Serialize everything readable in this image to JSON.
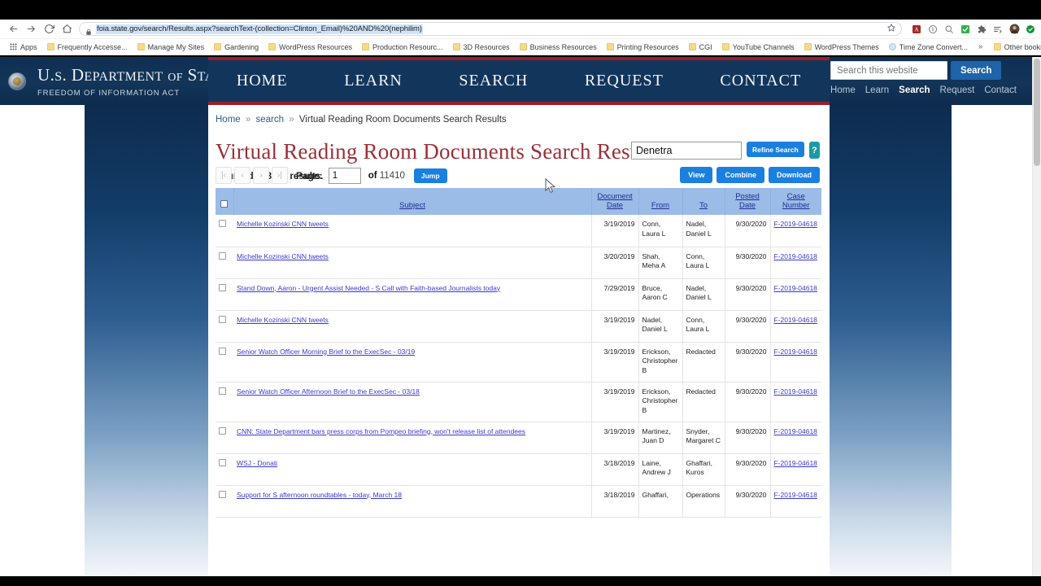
{
  "browser": {
    "url": "foia.state.gov/search/Results.aspx?searchText-(collection=Clinton_Email)%20AND%20(nephilim)",
    "back_icon": "back-arrow-icon",
    "forward_icon": "forward-arrow-icon",
    "reload_icon": "reload-icon",
    "home_icon": "home-icon",
    "lock_icon": "lock-icon",
    "star_icon": "bookmark-star-icon",
    "toolbar_icons": [
      "adobe-pdf-icon",
      "search-circle-icon",
      "magnifier-icon",
      "green-check-icon",
      "extensions-puzzle-icon",
      "reading-list-icon",
      "profile-avatar-icon",
      "update-circle-icon"
    ],
    "bookmarks": [
      {
        "label": "Apps",
        "icon": "apps-grid-icon"
      },
      {
        "label": "Frequently Accesse...",
        "icon": "folder-icon"
      },
      {
        "label": "Manage My Sites",
        "icon": "folder-icon"
      },
      {
        "label": "Gardening",
        "icon": "folder-icon"
      },
      {
        "label": "WordPress Resources",
        "icon": "folder-icon"
      },
      {
        "label": "Production Resourc...",
        "icon": "folder-icon"
      },
      {
        "label": "3D Resources",
        "icon": "folder-icon"
      },
      {
        "label": "Business Resources",
        "icon": "folder-icon"
      },
      {
        "label": "Printing Resources",
        "icon": "folder-icon"
      },
      {
        "label": "CGI",
        "icon": "folder-icon"
      },
      {
        "label": "YouTube Channels",
        "icon": "folder-icon"
      },
      {
        "label": "WordPress Themes",
        "icon": "folder-icon"
      },
      {
        "label": "Time Zone Convert...",
        "icon": "link-icon"
      }
    ],
    "overflow_label": "»",
    "other_bookmarks": {
      "label": "Other bookmarks",
      "icon": "folder-icon"
    }
  },
  "site_header": {
    "seal_icon": "department-of-state-seal-icon",
    "title_us": "U.S. D",
    "title_line": "U.S. DEPARTMENT OF STATE",
    "subtitle": "FREEDOM OF INFORMATION ACT",
    "search_placeholder": "Search this website",
    "search_value": "",
    "search_button": "Search",
    "mini_links": [
      {
        "label": "Home",
        "active": false
      },
      {
        "label": "Learn",
        "active": false
      },
      {
        "label": "Search",
        "active": true
      },
      {
        "label": "Request",
        "active": false
      },
      {
        "label": "Contact",
        "active": false
      }
    ]
  },
  "main_nav": [
    "HOME",
    "LEARN",
    "SEARCH",
    "REQUEST",
    "CONTACT"
  ],
  "breadcrumb": {
    "items": [
      "Home",
      "search"
    ],
    "current": "Virtual Reading Room Documents Search Results",
    "separator": "»"
  },
  "page": {
    "title": "Virtual Reading Room Documents Search Results",
    "returned": "returned 228195 results."
  },
  "refine": {
    "input_value": "Denetra",
    "input_placeholder": "",
    "refine_button": "Refine Search",
    "help_button": "?",
    "view_button": "View",
    "combine_button": "Combine",
    "download_button": "Download"
  },
  "pager": {
    "first_icon": "first-page-icon",
    "prev_icon": "previous-page-icon",
    "next_icon": "next-page-icon",
    "last_icon": "last-page-icon",
    "first_glyph": "|‹",
    "prev_glyph": "‹",
    "next_glyph": "›",
    "last_glyph": "›|",
    "page_label": "Page:",
    "page_value": "1",
    "of_label": "of",
    "total_pages": "11410",
    "jump_button": "Jump"
  },
  "table": {
    "select_all_name": "select-all-checkbox",
    "columns": [
      {
        "key": "check",
        "label": ""
      },
      {
        "key": "subject",
        "label": "Subject"
      },
      {
        "key": "docdate",
        "label": "Document Date"
      },
      {
        "key": "from",
        "label": "From"
      },
      {
        "key": "to",
        "label": "To"
      },
      {
        "key": "posted",
        "label": "Posted Date"
      },
      {
        "key": "case",
        "label": "Case Number"
      }
    ],
    "rows": [
      {
        "subject": "Michelle Kozinski CNN tweets",
        "docdate": "3/19/2019",
        "from": "Conn, Laura L",
        "to": "Nadel, Daniel L",
        "posted": "9/30/2020",
        "case": "F-2019-04618"
      },
      {
        "subject": "Michelle Kozinski CNN tweets",
        "docdate": "3/20/2019",
        "from": "Shah, Meha A",
        "to": "Conn, Laura L",
        "posted": "9/30/2020",
        "case": "F-2019-04618"
      },
      {
        "subject": "Stand Down, Aaron - Urgent Assist Needed - S Call with Faith-based Journalists today",
        "docdate": "7/29/2019",
        "from": "Bruce, Aaron C",
        "to": "Nadel, Daniel L",
        "posted": "9/30/2020",
        "case": "F-2019-04618"
      },
      {
        "subject": "Michelle Kozinski CNN tweets",
        "docdate": "3/19/2019",
        "from": "Nadel, Daniel L",
        "to": "Conn, Laura L",
        "posted": "9/30/2020",
        "case": "F-2019-04618"
      },
      {
        "subject": "Senior Watch Officer Morning Brief to the ExecSec - 03/19",
        "docdate": "3/19/2019",
        "from": "Erickson, Christopher B",
        "to": "Redacted",
        "posted": "9/30/2020",
        "case": "F-2019-04618"
      },
      {
        "subject": "Senior Watch Officer Afternoon Brief to the ExecSec - 03/18",
        "docdate": "3/19/2019",
        "from": "Erickson, Christopher B",
        "to": "Redacted",
        "posted": "9/30/2020",
        "case": "F-2019-04618"
      },
      {
        "subject": "CNN: State Department bars press corps from Pompeo briefing, won't release list of attendees",
        "docdate": "3/19/2019",
        "from": "Martinez, Juan D",
        "to": "Snyder, Margaret C",
        "posted": "9/30/2020",
        "case": "F-2019-04618"
      },
      {
        "subject": "WSJ - Donati",
        "docdate": "3/18/2019",
        "from": "Laine, Andrew J",
        "to": "Ghaffari, Kuros",
        "posted": "9/30/2020",
        "case": "F-2019-04618"
      },
      {
        "subject": "Support for S afternoon roundtables - today, March 18",
        "docdate": "3/18/2019",
        "from": "Ghaffari,",
        "to": "Operations",
        "posted": "9/30/2020",
        "case": "F-2019-04618"
      }
    ]
  }
}
